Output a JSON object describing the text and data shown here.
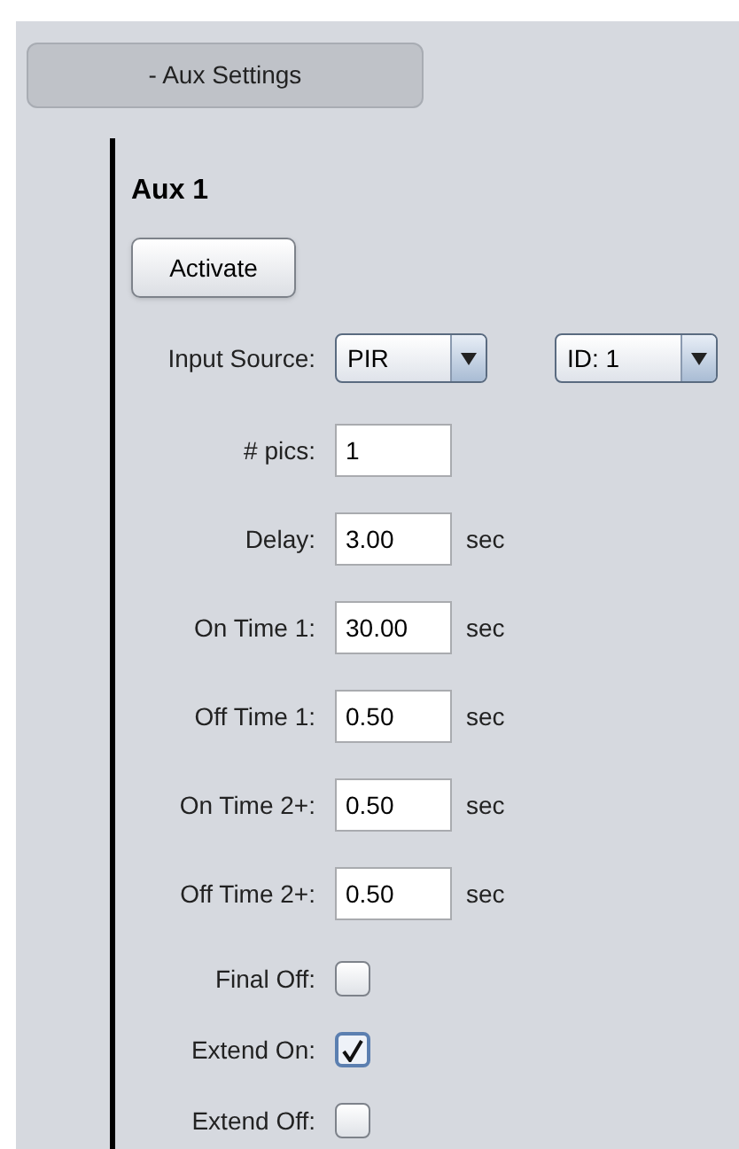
{
  "section_toggle": {
    "label": "- Aux Settings"
  },
  "aux": {
    "title": "Aux 1",
    "activate_button": "Activate",
    "input_source": {
      "label": "Input Source:",
      "source": "PIR",
      "id": "ID: 1"
    },
    "rows": [
      {
        "kind": "field",
        "label": "# pics:",
        "value": "1"
      },
      {
        "kind": "field",
        "label": "Delay:",
        "value": "3.00",
        "unit": "sec"
      },
      {
        "kind": "field",
        "label": "On Time 1:",
        "value": "30.00",
        "unit": "sec"
      },
      {
        "kind": "field",
        "label": "Off Time 1:",
        "value": "0.50",
        "unit": "sec"
      },
      {
        "kind": "field",
        "label": "On Time 2+:",
        "value": "0.50",
        "unit": "sec"
      },
      {
        "kind": "field",
        "label": "Off Time 2+:",
        "value": "0.50",
        "unit": "sec"
      },
      {
        "kind": "checkbox",
        "label": "Final Off:",
        "checked": false
      },
      {
        "kind": "checkbox",
        "label": "Extend On:",
        "checked": true
      },
      {
        "kind": "checkbox",
        "label": "Extend Off:",
        "checked": false
      }
    ]
  }
}
